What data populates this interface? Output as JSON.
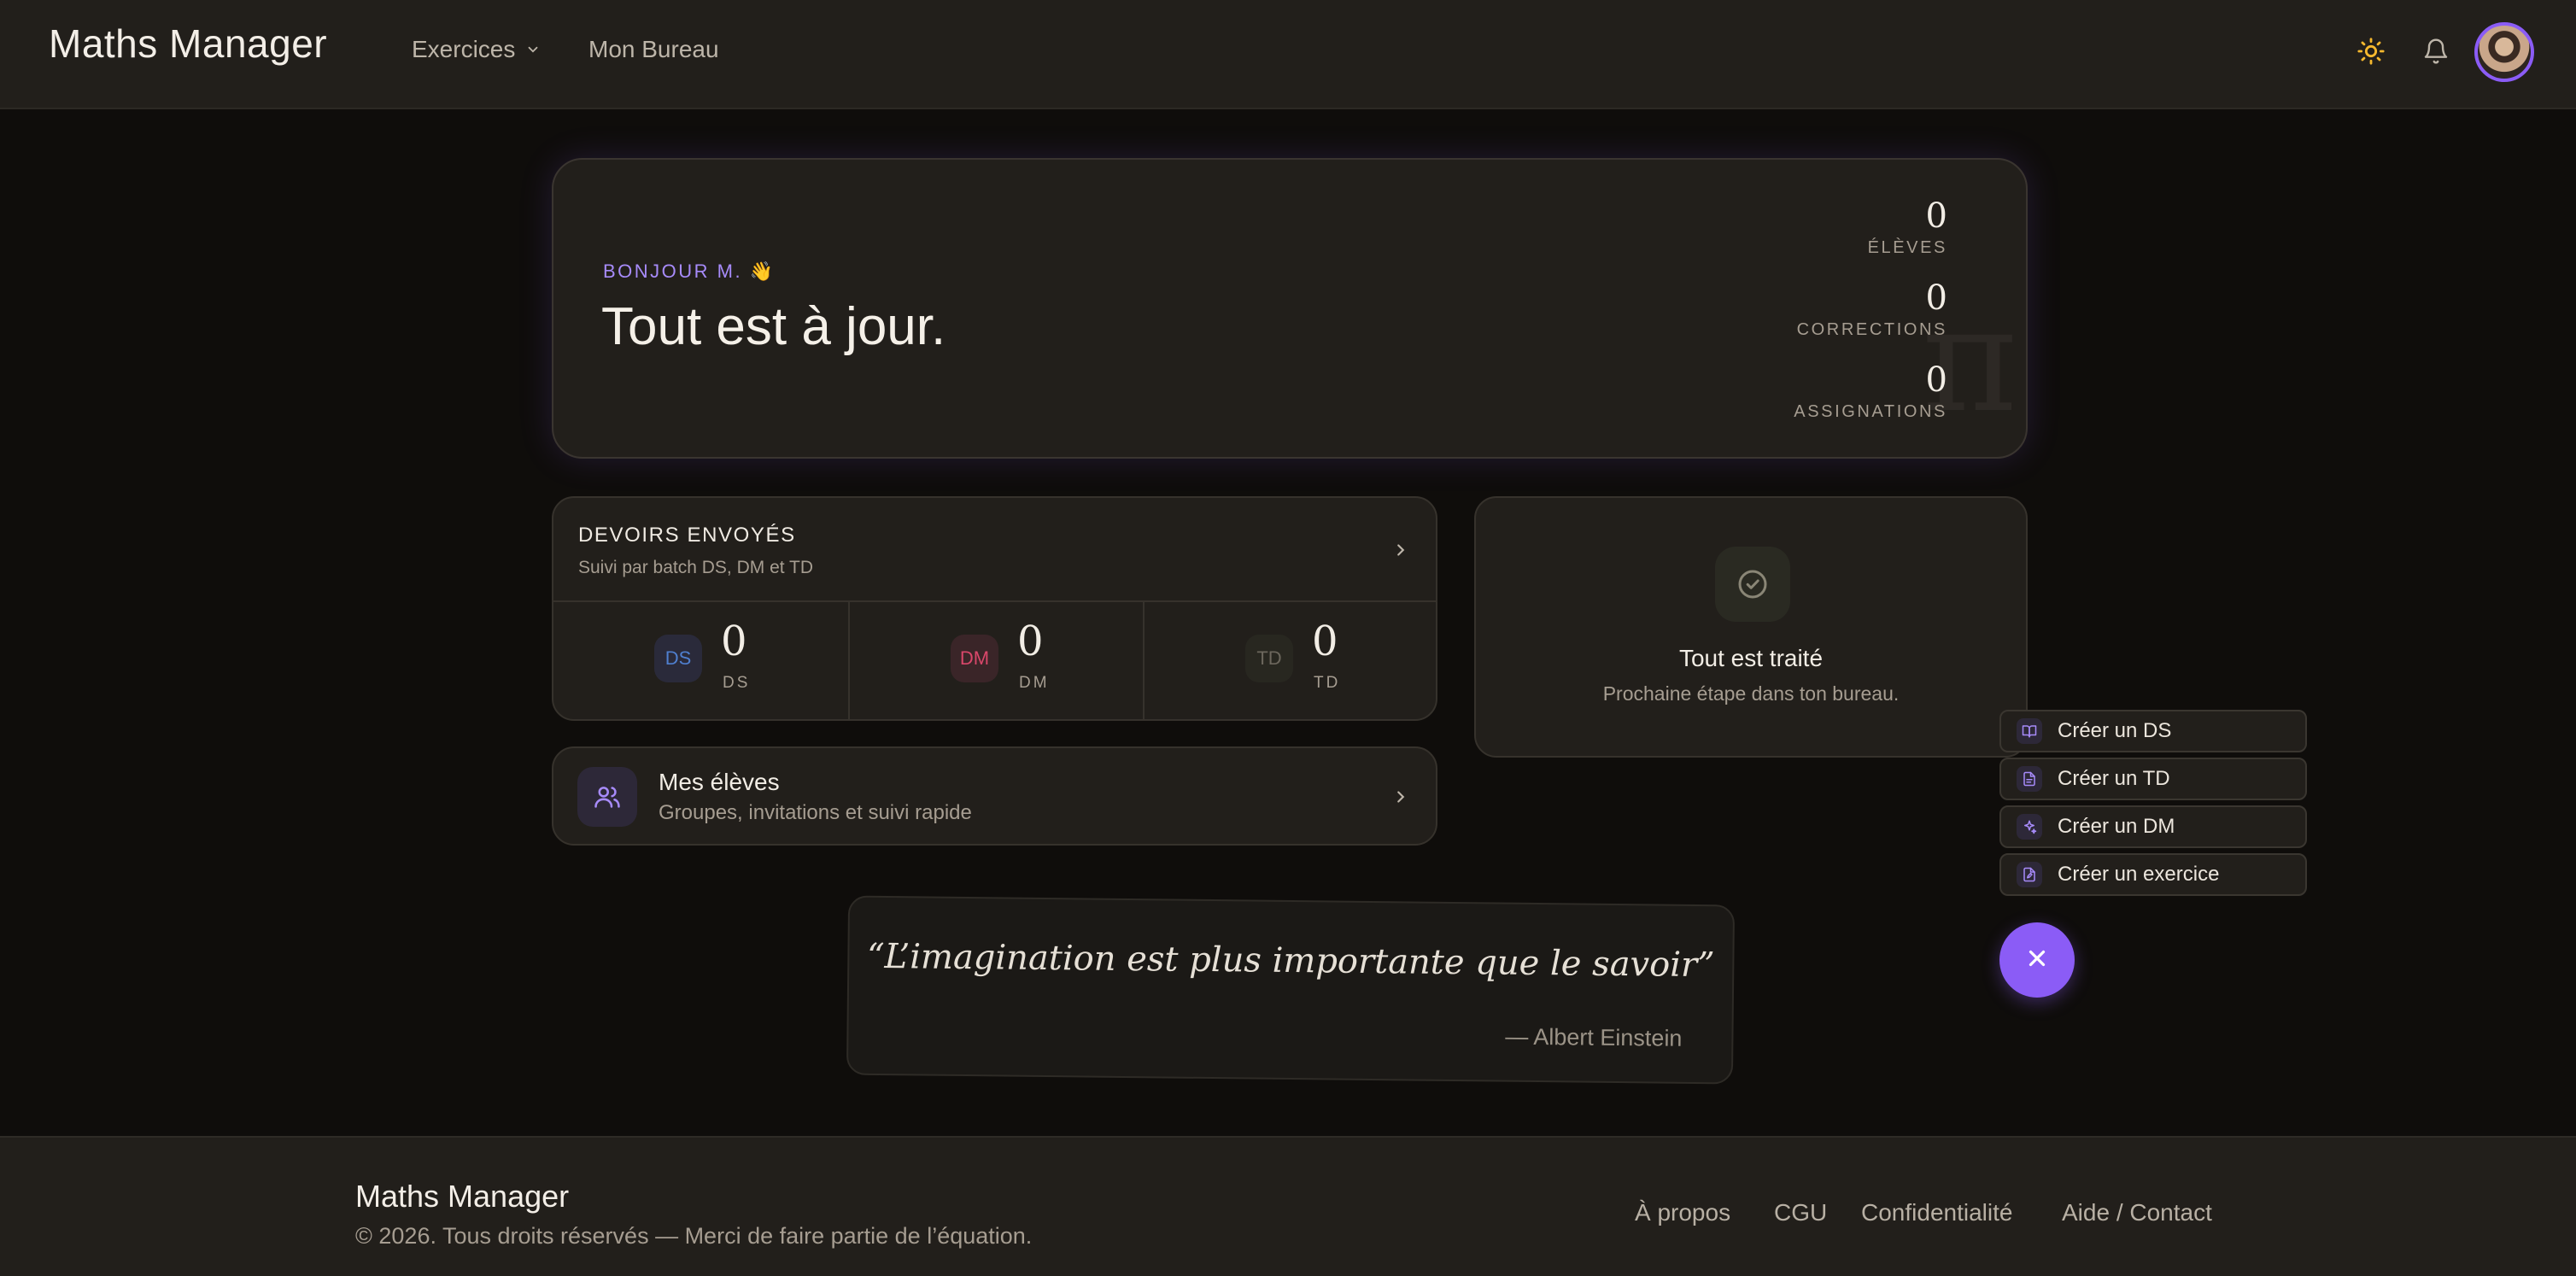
{
  "header": {
    "logo": "Maths Manager",
    "nav": {
      "exercices": "Exercices",
      "bureau": "Mon Bureau"
    },
    "icons": [
      "sun-icon",
      "bell-icon",
      "avatar"
    ]
  },
  "hero": {
    "greeting": "BONJOUR M. 👋",
    "title": "Tout est à jour.",
    "decor": "π",
    "stats": [
      {
        "value": "0",
        "label": "ÉLÈVES"
      },
      {
        "value": "0",
        "label": "CORRECTIONS"
      },
      {
        "value": "0",
        "label": "ASSIGNATIONS"
      }
    ]
  },
  "devoirs": {
    "title": "DEVOIRS ENVOYÉS",
    "subtitle": "Suivi par batch DS, DM et TD",
    "items": [
      {
        "badge": "DS",
        "value": "0",
        "label": "DS",
        "color": "#4f7fcf"
      },
      {
        "badge": "DM",
        "value": "0",
        "label": "DM",
        "color": "#d9476a"
      },
      {
        "badge": "TD",
        "value": "0",
        "label": "TD",
        "color": "#6c675d"
      }
    ]
  },
  "traite": {
    "title": "Tout est traité",
    "subtitle": "Prochaine étape dans ton bureau."
  },
  "eleves": {
    "title": "Mes élèves",
    "subtitle": "Groupes, invitations et suivi rapide"
  },
  "quote": {
    "text": "“L’imagination est plus importante que le savoir”",
    "author": "— Albert Einstein"
  },
  "quick_actions": [
    {
      "label": "Créer un DS",
      "icon": "book-icon"
    },
    {
      "label": "Créer un TD",
      "icon": "file-text-icon"
    },
    {
      "label": "Créer un DM",
      "icon": "sparkles-icon"
    },
    {
      "label": "Créer un exercice",
      "icon": "file-edit-icon"
    }
  ],
  "footer": {
    "logo": "Maths Manager",
    "copyright": "© 2026. Tous droits réservés — Merci de faire partie de l’équation.",
    "links": {
      "apropos": "À propos",
      "cgu": "CGU",
      "confidentialite": "Confidentialité",
      "aide": "Aide / Contact"
    }
  },
  "colors": {
    "accent": "#8b5cf6",
    "background": "#0f0d0b",
    "card": "#221f1b",
    "sun": "#f5b82e"
  }
}
